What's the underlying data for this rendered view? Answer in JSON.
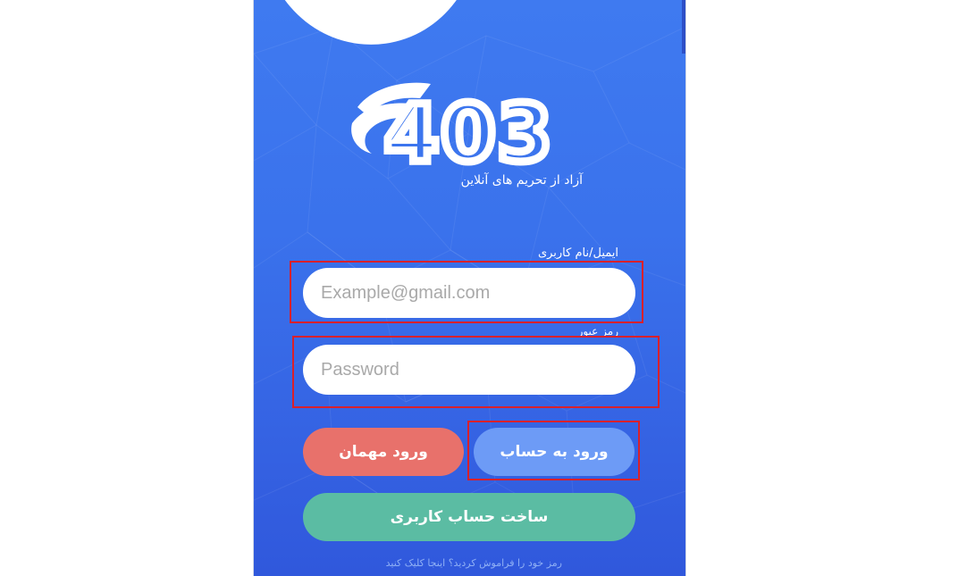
{
  "app": {
    "logo_text": "403",
    "tagline": "آزاد از تحریم های آنلاین"
  },
  "login_form": {
    "email_label": "ایمیل/نام کاربری",
    "email_placeholder": "Example@gmail.com",
    "email_value": "",
    "password_label": "رمز عبور",
    "password_placeholder": "Password",
    "password_value": ""
  },
  "buttons": {
    "guest_login": "ورود مهمان",
    "account_login": "ورود به حساب",
    "create_account": "ساخت حساب کاربری"
  },
  "forgot_password_link": "رمز خود را فراموش کردید؟ اینجا کلیک کنید",
  "colors": {
    "background_blue": "#3a72ec",
    "guest_button": "#e8716b",
    "login_button": "#6d9bf6",
    "signup_button": "#5bbca3",
    "highlight_box": "#d9202b"
  }
}
